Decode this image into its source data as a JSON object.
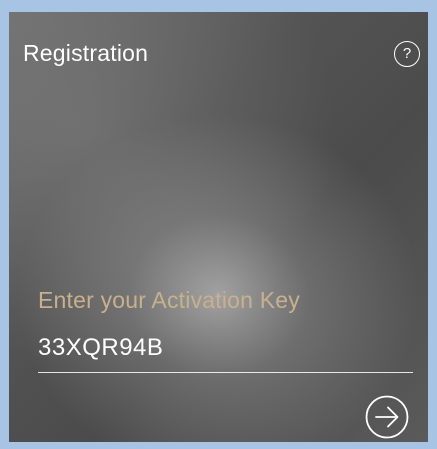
{
  "header": {
    "title": "Registration",
    "help_label": "?"
  },
  "activation": {
    "prompt": "Enter your Activation Key",
    "key_value": "33XQR94B"
  },
  "actions": {
    "next_icon": "arrow-right-circle-icon"
  },
  "colors": {
    "prompt_text": "#c9b08c",
    "outer_border": "#a7c4e4",
    "text": "#ffffff"
  }
}
